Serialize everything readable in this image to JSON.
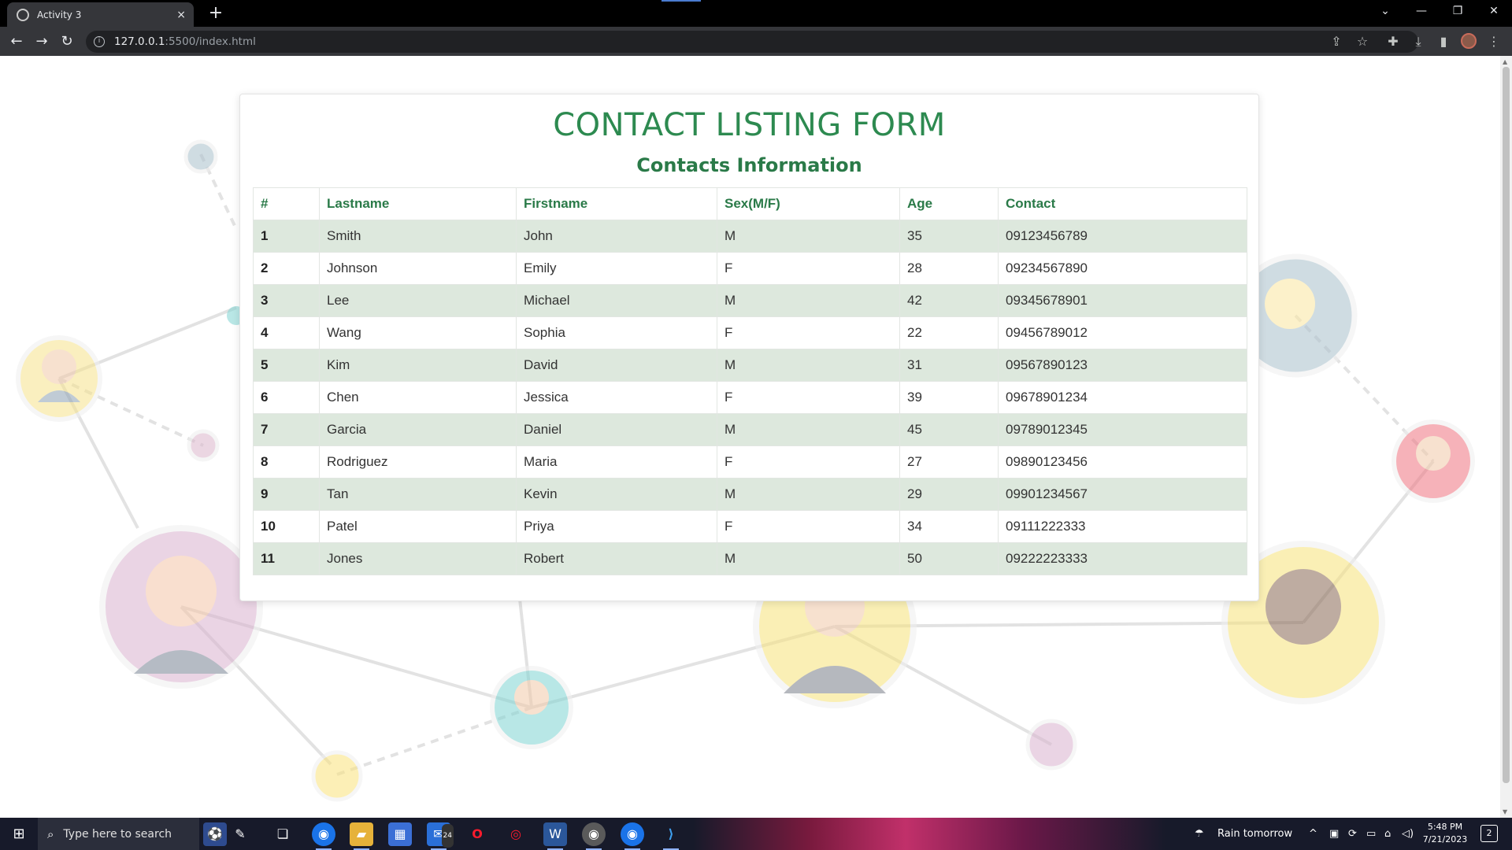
{
  "browser": {
    "tab_title": "Activity 3",
    "tab_close": "×",
    "new_tab": "+",
    "url_host": "127.0.0.1",
    "url_rest": ":5500/index.html"
  },
  "page": {
    "heading": "CONTACT LISTING FORM",
    "subheading": "Contacts Information",
    "table": {
      "headers": [
        "#",
        "Lastname",
        "Firstname",
        "Sex(M/F)",
        "Age",
        "Contact"
      ],
      "rows": [
        [
          "1",
          "Smith",
          "John",
          "M",
          "35",
          "09123456789"
        ],
        [
          "2",
          "Johnson",
          "Emily",
          "F",
          "28",
          "09234567890"
        ],
        [
          "3",
          "Lee",
          "Michael",
          "M",
          "42",
          "09345678901"
        ],
        [
          "4",
          "Wang",
          "Sophia",
          "F",
          "22",
          "09456789012"
        ],
        [
          "5",
          "Kim",
          "David",
          "M",
          "31",
          "09567890123"
        ],
        [
          "6",
          "Chen",
          "Jessica",
          "F",
          "39",
          "09678901234"
        ],
        [
          "7",
          "Garcia",
          "Daniel",
          "M",
          "45",
          "09789012345"
        ],
        [
          "8",
          "Rodriguez",
          "Maria",
          "F",
          "27",
          "09890123456"
        ],
        [
          "9",
          "Tan",
          "Kevin",
          "M",
          "29",
          "09901234567"
        ],
        [
          "10",
          "Patel",
          "Priya",
          "F",
          "34",
          "09111222333"
        ],
        [
          "11",
          "Jones",
          "Robert",
          "M",
          "50",
          "09222223333"
        ]
      ]
    }
  },
  "taskbar": {
    "search_placeholder": "Type here to search",
    "mail_badge": "24",
    "weather": "Rain tomorrow",
    "time": "5:48 PM",
    "date": "7/21/2023",
    "notification_count": "2"
  },
  "colors": {
    "heading": "#2d8a50",
    "table_header": "#2a7a48",
    "row_stripe": "#dde8dd"
  }
}
